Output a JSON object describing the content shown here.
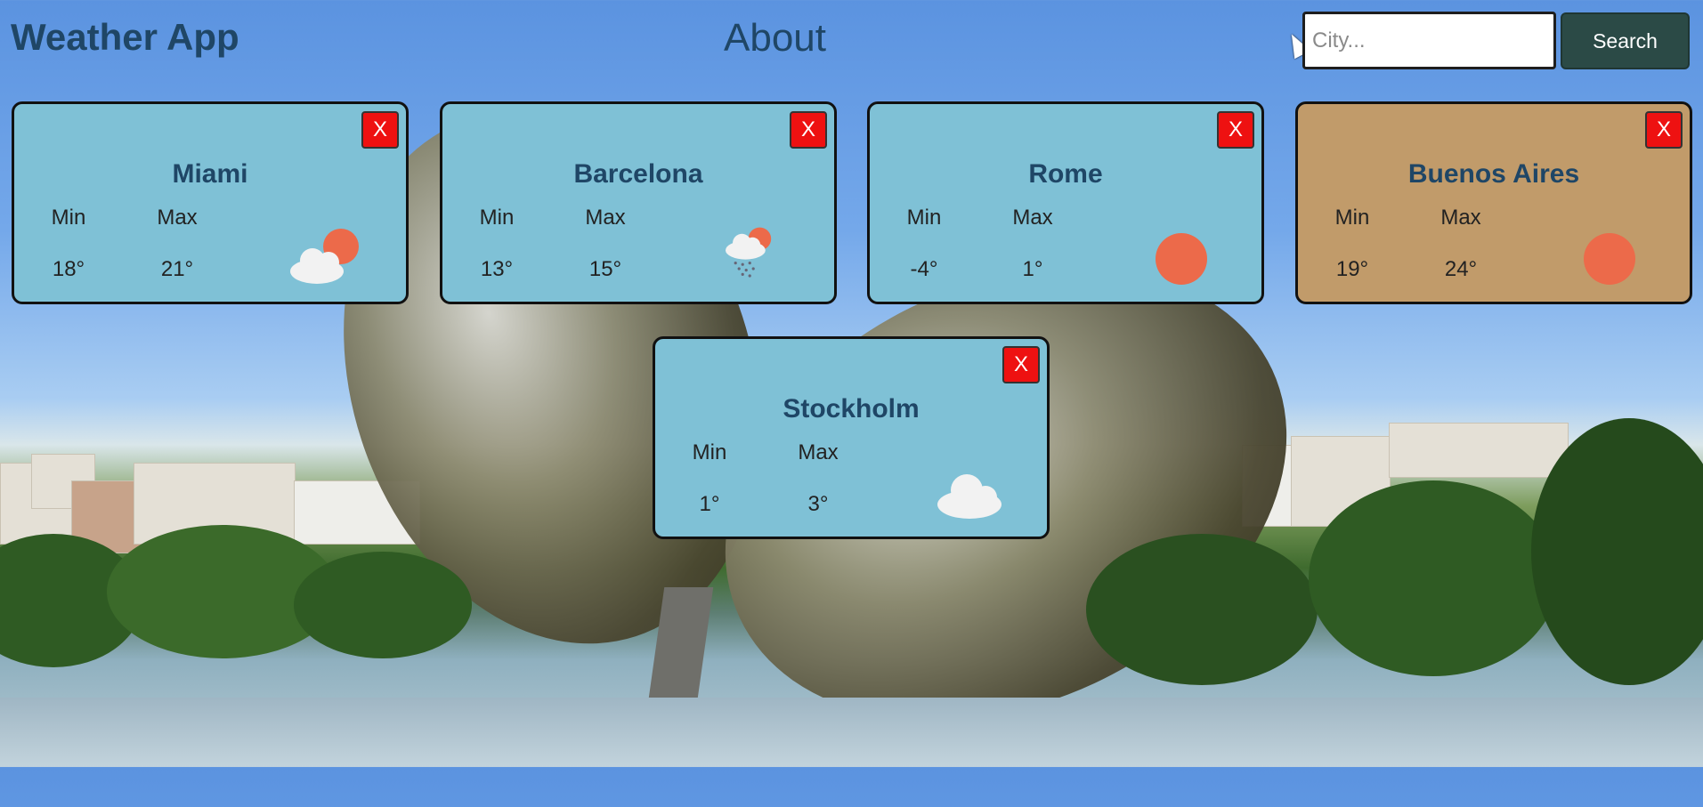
{
  "app": {
    "title": "Weather App"
  },
  "nav": {
    "about_label": "About"
  },
  "search": {
    "placeholder": "City...",
    "button_label": "Search"
  },
  "colors": {
    "card_default": "#7fc1d6",
    "card_highlight": "#c19b6a",
    "close_button": "#ee1111",
    "search_button": "#2b4a46"
  },
  "cards": [
    {
      "city": "Miami",
      "min_label": "Min",
      "max_label": "Max",
      "min": "18°",
      "max": "21°",
      "icon": "sun-behind-cloud-icon",
      "close_label": "X"
    },
    {
      "city": "Barcelona",
      "min_label": "Min",
      "max_label": "Max",
      "min": "13°",
      "max": "15°",
      "icon": "rain-cloud-sun-icon",
      "close_label": "X"
    },
    {
      "city": "Rome",
      "min_label": "Min",
      "max_label": "Max",
      "min": "-4°",
      "max": "1°",
      "icon": "sun-icon",
      "close_label": "X"
    },
    {
      "city": "Buenos Aires",
      "min_label": "Min",
      "max_label": "Max",
      "min": "19°",
      "max": "24°",
      "icon": "sun-icon",
      "close_label": "X"
    },
    {
      "city": "Stockholm",
      "min_label": "Min",
      "max_label": "Max",
      "min": "1°",
      "max": "3°",
      "icon": "cloud-icon",
      "close_label": "X"
    }
  ]
}
